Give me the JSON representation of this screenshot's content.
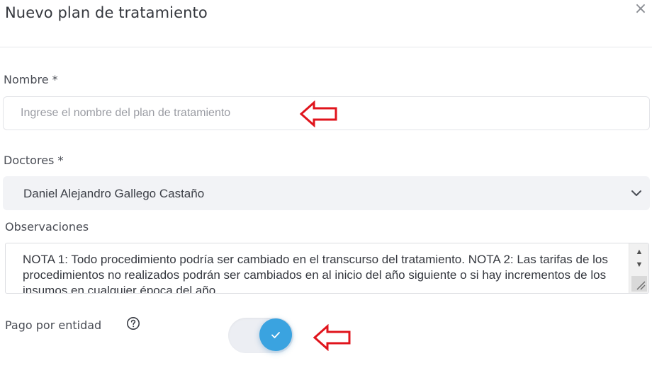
{
  "modal": {
    "title": "Nuevo plan de tratamiento",
    "close_glyph": "×"
  },
  "form": {
    "nombre": {
      "label": "Nombre *",
      "placeholder": "Ingrese el nombre del plan de tratamiento",
      "value": ""
    },
    "doctores": {
      "label": "Doctores *",
      "selected": "Daniel Alejandro Gallego Castaño"
    },
    "observaciones": {
      "label": "Observaciones",
      "value": "NOTA 1: Todo procedimiento podría ser cambiado en el transcurso del tratamiento. NOTA 2: Las tarifas de los procedimientos no realizados podrán ser cambiados en al inicio del año siguiente o si hay incrementos de los insumos en cualquier época del año."
    },
    "pago_por_entidad": {
      "label": "Pago por entidad",
      "enabled": true
    }
  },
  "icons": {
    "close": "close-icon",
    "chevron": "chevron-down-icon",
    "help": "help-circle-icon",
    "check": "check-icon",
    "arrow": "left-arrow-annotation-icon"
  },
  "colors": {
    "accent": "#3aa3e0",
    "annotation": "#e0141c",
    "select_bg": "#f2f3f6"
  }
}
